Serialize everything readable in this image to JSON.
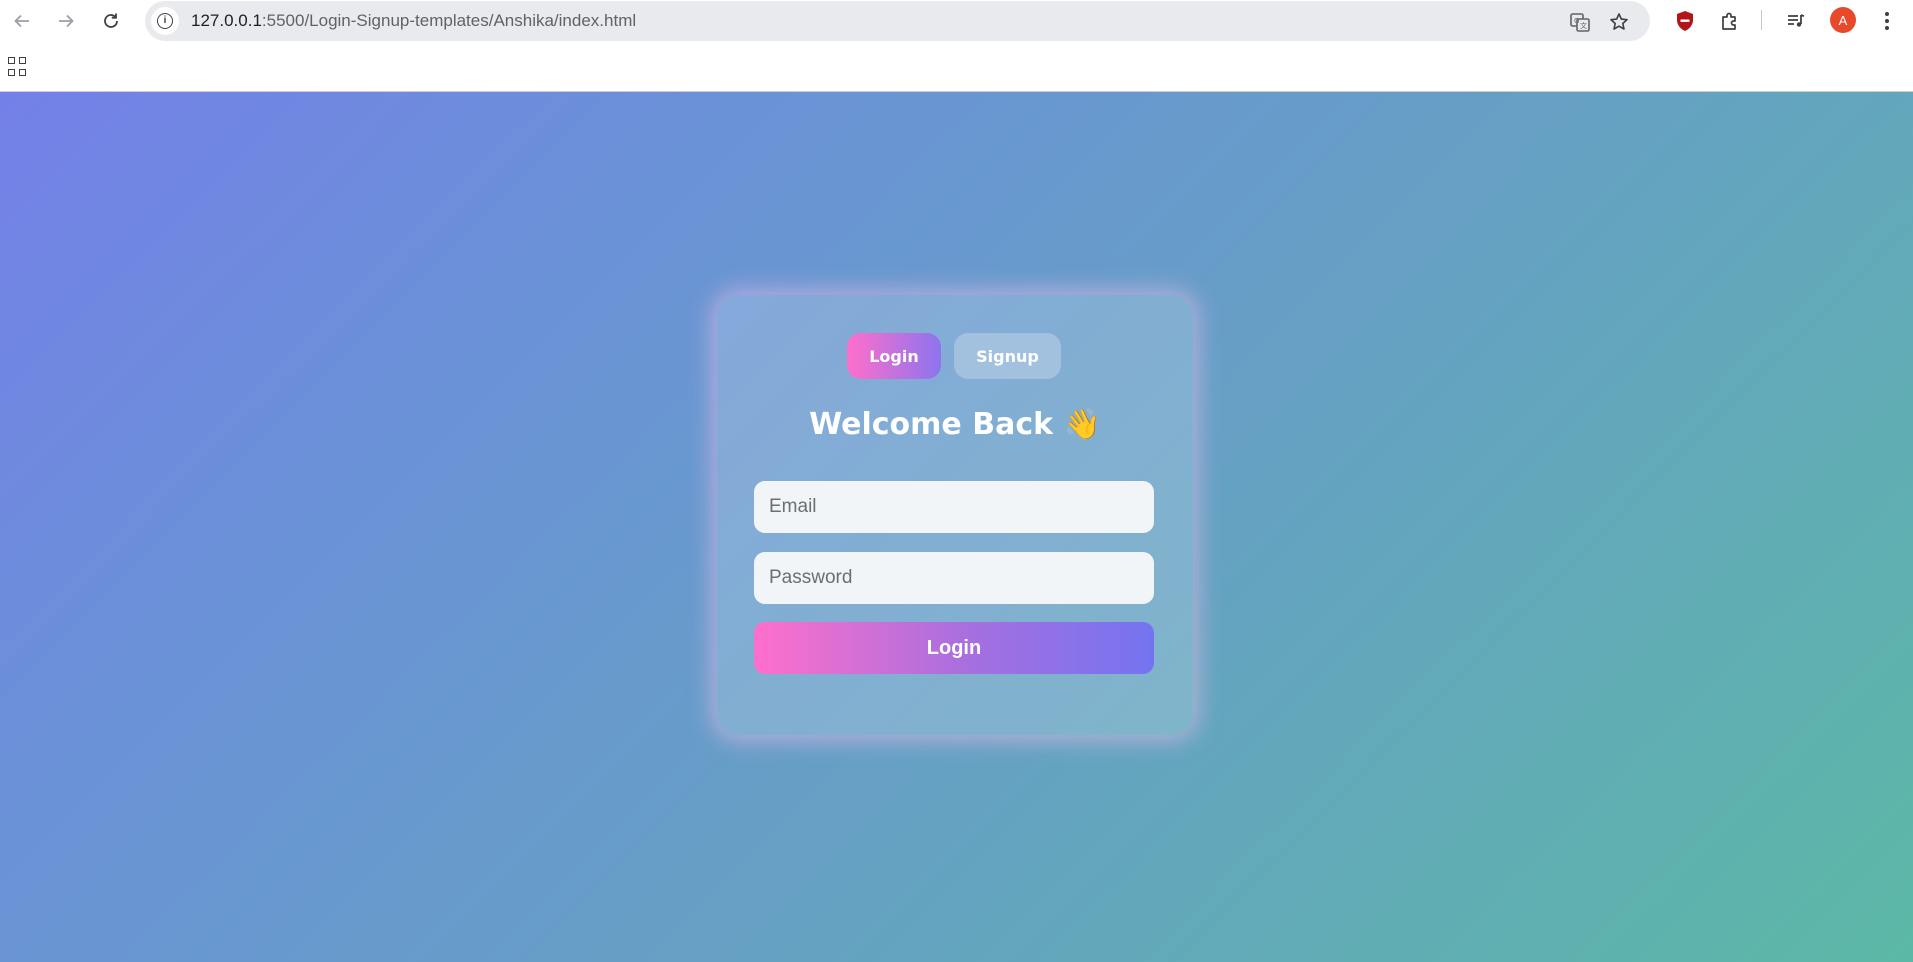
{
  "browser": {
    "url_host": "127.0.0.1",
    "url_path": ":5500/Login-Signup-templates/Anshika/index.html",
    "back_icon": "arrow-left-icon",
    "forward_icon": "arrow-right-icon",
    "reload_icon": "reload-icon",
    "site_info_icon": "info-icon",
    "translate_icon": "translate-icon",
    "bookmark_icon": "star-icon",
    "extension_shield_icon": "shield-icon",
    "extensions_icon": "puzzle-icon",
    "media_icon": "media-queue-icon",
    "profile_initial": "A",
    "profile_color": "#e8492b",
    "menu_icon": "kebab-menu-icon",
    "apps_icon": "apps-grid-icon"
  },
  "auth_card": {
    "tabs": {
      "login": "Login",
      "signup": "Signup",
      "active": "Login"
    },
    "title": "Welcome Back 👋",
    "email_placeholder": "Email",
    "password_placeholder": "Password",
    "submit_label": "Login",
    "colors": {
      "gradient_start": "#ff6fcb",
      "gradient_end": "#7474f0",
      "background_start": "#7480e8",
      "background_end": "#5cb8a6"
    }
  }
}
